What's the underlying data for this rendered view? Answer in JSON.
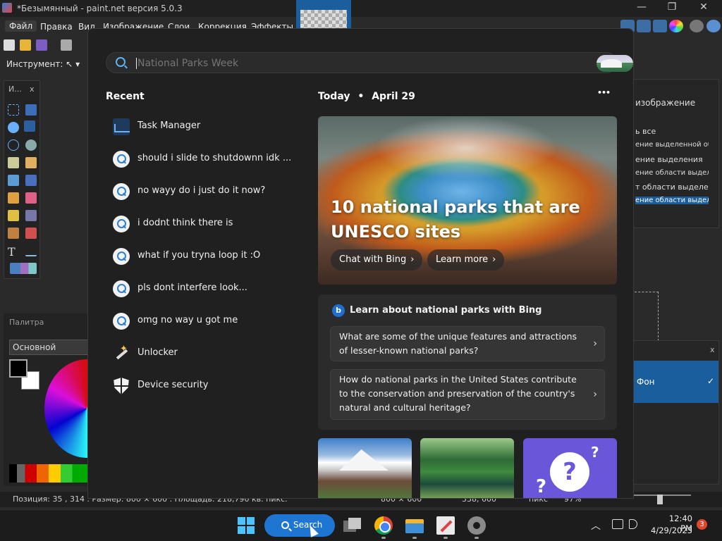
{
  "paintnet": {
    "window_title": "*Безымянный - paint.net версия 5.0.3",
    "window_controls": {
      "minimize": "—",
      "maximize": "❐",
      "close": "✕"
    },
    "menu": [
      "Файл",
      "Правка",
      "Вид",
      "Изображение",
      "Слои",
      "Коррекция",
      "Эффекты"
    ],
    "tool_label": "Инструмент:",
    "tools_panel": {
      "header": "И...",
      "close": "x"
    },
    "palette": {
      "header": "Палитра",
      "selected": "Основной"
    },
    "history_items": [
      "изображение",
      "ь все",
      "ение выделенной области",
      "ение выделения",
      "ение области выделения",
      "т области выделения",
      "ение области выделения"
    ],
    "layers": {
      "layer_name": "Фон",
      "close": "x"
    },
    "status": {
      "position": "Позиция: 35 , 314 . Размер: 800 × 600 . Площадь: 218,790 кв. пикс.",
      "image_size": "800 × 600",
      "selection_size": "338, 600",
      "units": "пикс",
      "zoom": "97%"
    }
  },
  "search": {
    "placeholder": "National Parks Week",
    "recent_title": "Recent",
    "recent_items": [
      {
        "label": "Task Manager",
        "icon": "task-manager-icon"
      },
      {
        "label": "should i slide to shutdownn idk ...",
        "icon": "search-icon"
      },
      {
        "label": "no wayy do i just do it now?",
        "icon": "search-icon"
      },
      {
        "label": "i dodnt think there is",
        "icon": "search-icon"
      },
      {
        "label": "what if you tryna loop it :O",
        "icon": "search-icon"
      },
      {
        "label": "pls dont interfere look...",
        "icon": "search-icon"
      },
      {
        "label": "omg no way u got me",
        "icon": "search-icon"
      },
      {
        "label": "Unlocker",
        "icon": "magic-wand-icon"
      },
      {
        "label": "Device security",
        "icon": "shield-icon"
      }
    ],
    "today": {
      "label": "Today",
      "separator": "•",
      "date": "April 29"
    },
    "more": "•••",
    "hero": {
      "title": "10 national parks that are UNESCO sites",
      "chat_button": "Chat with Bing",
      "learn_button": "Learn more"
    },
    "bing_card": {
      "logo": "b",
      "title": "Learn about national parks with Bing",
      "questions": [
        "What are some of the unique features and attractions of lesser-known national parks?",
        "How do national parks in the United States contribute to the conservation and preservation of the country's natural and cultural heritage?"
      ]
    }
  },
  "taskbar": {
    "search_label": "Search",
    "time": "12:40 PM",
    "date": "4/29/2023",
    "notifications": "3",
    "apps": [
      "task-view-icon",
      "chrome-icon",
      "file-explorer-icon",
      "paint-net-icon",
      "settings-icon"
    ]
  },
  "colors": {
    "accent": "#1f76d2",
    "flyout_bg": "#202020",
    "selection": "#1b5e9e",
    "badge": "#e2462c"
  }
}
